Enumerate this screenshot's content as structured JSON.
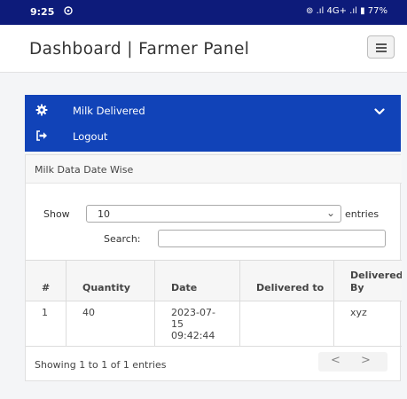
{
  "status": {
    "time": "9:25",
    "app_icon": "whatsapp-icon",
    "right": "⊚ .ıl 4G+ .ıl ▮ 77%"
  },
  "header": {
    "title": "Dashboard | Farmer Panel",
    "menu_icon": "hamburger-icon"
  },
  "nav": {
    "items": [
      {
        "label": "Milk Delivered",
        "icon": "gear-icon"
      },
      {
        "label": "Logout",
        "icon": "logout-icon"
      }
    ]
  },
  "card": {
    "title": "Milk Data Date Wise",
    "show_label": "Show",
    "entries_value": "10",
    "entries_label": "entries",
    "search_label": "Search:",
    "search_value": ""
  },
  "table": {
    "columns": [
      "#",
      "Quantity",
      "Date",
      "Delivered to",
      "Delivered By"
    ],
    "rows": [
      [
        "1",
        "40",
        "2023-07-15 09:42:44",
        "",
        "xyz"
      ]
    ]
  },
  "footer": {
    "info": "Showing 1 to 1 of 1 entries",
    "prev": "<",
    "next": ">"
  },
  "colors": {
    "primary": "#1143b8",
    "statusbar": "#0d1b7a"
  }
}
